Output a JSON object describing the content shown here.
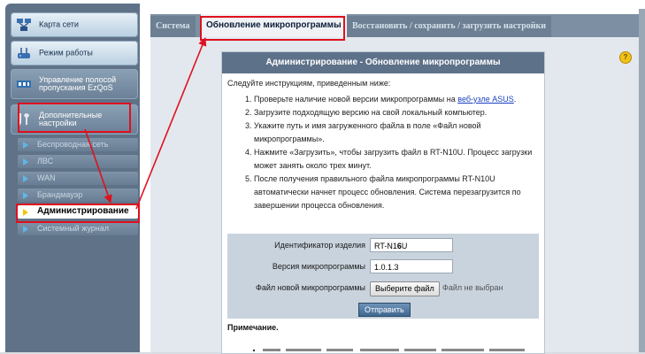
{
  "sidebar": {
    "main_items": [
      {
        "label": "Карта сети",
        "icon": "network-map-icon"
      },
      {
        "label": "Режим работы",
        "icon": "router-icon"
      },
      {
        "label": "Управление полосой пропускания EzQoS",
        "icon": "qos-icon"
      },
      {
        "label": "Дополнительные настройки",
        "icon": "tools-icon"
      }
    ],
    "sub_items": [
      {
        "label": "Беспроводная сеть"
      },
      {
        "label": "ЛВС"
      },
      {
        "label": "WAN"
      },
      {
        "label": "Брандмауэр"
      },
      {
        "label": "Администрирование"
      },
      {
        "label": "Системный журнал"
      }
    ]
  },
  "tabs": [
    {
      "label": "Система"
    },
    {
      "label": "Обновление микропрограммы"
    },
    {
      "label": "Восстановить / сохранить / загрузить настройки"
    }
  ],
  "panel": {
    "title": "Администрирование - Обновление микропрограммы",
    "intro": "Следуйте инструкциям, приведенным ниже:",
    "step1_prefix": "Проверьте наличие новой версии микропрограммы на ",
    "step1_link": "веб-узле ASUS",
    "step1_suffix": ".",
    "step2": "Загрузите подходящую версию на свой локальный компьютер.",
    "step3": "Укажите путь и имя загруженного файла в поле «Файл новой микропрограммы».",
    "step4": "Нажмите «Загрузить», чтобы загрузить файл в RT-N10U. Процесс загрузки может занять около трех минут.",
    "step5": "После получения правильного файла микропрограммы RT-N10U автоматически начнет процесс обновления. Система перезагрузится по завершении процесса обновления."
  },
  "form": {
    "product_label": "Идентификатор изделия",
    "product_value": "RT-N16U",
    "version_label": "Версия микропрограммы",
    "version_value": "1.0.1.3",
    "file_label": "Файл новой микропрограммы",
    "choose_button": "Выберите файл",
    "no_file": "Файл не выбран",
    "submit": "Отправить"
  },
  "note_label": "Примечание.",
  "help_icon": "?",
  "colors": {
    "highlight": "#e0101e",
    "header": "#5d7189",
    "link": "#1a3fc0"
  }
}
